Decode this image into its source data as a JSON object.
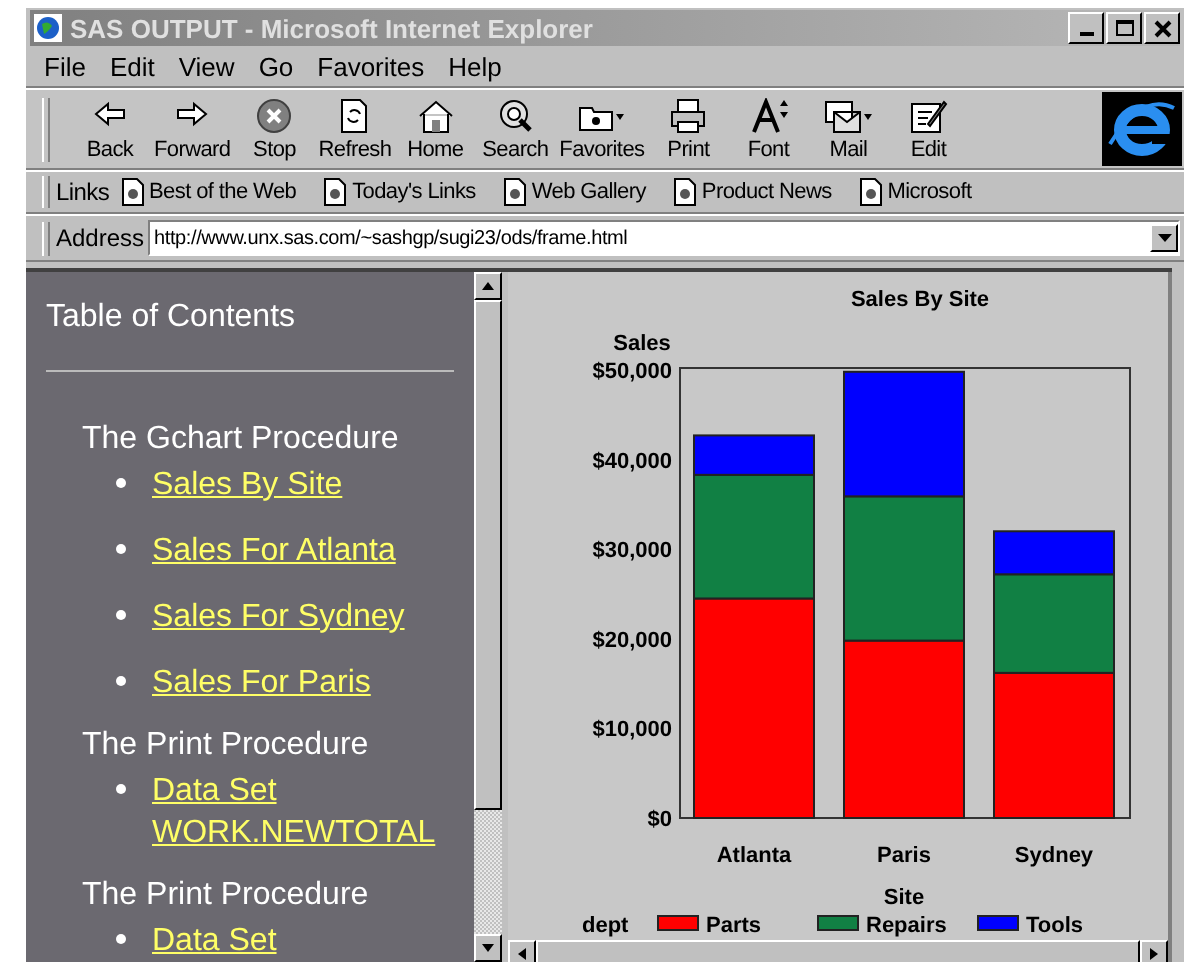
{
  "window": {
    "title": "SAS OUTPUT - Microsoft Internet Explorer"
  },
  "menu": [
    "File",
    "Edit",
    "View",
    "Go",
    "Favorites",
    "Help"
  ],
  "toolbar": [
    {
      "label": "Back",
      "kind": "back"
    },
    {
      "label": "Forward",
      "kind": "forward"
    },
    {
      "label": "Stop",
      "kind": "stop"
    },
    {
      "label": "Refresh",
      "kind": "refresh"
    },
    {
      "label": "Home",
      "kind": "home"
    },
    {
      "label": "Search",
      "kind": "search"
    },
    {
      "label": "Favorites",
      "kind": "favorites"
    },
    {
      "label": "Print",
      "kind": "print"
    },
    {
      "label": "Font",
      "kind": "font"
    },
    {
      "label": "Mail",
      "kind": "mail"
    },
    {
      "label": "Edit",
      "kind": "edit"
    }
  ],
  "links": {
    "label": "Links",
    "items": [
      "Best of the Web",
      "Today's Links",
      "Web Gallery",
      "Product News",
      "Microsoft"
    ]
  },
  "address": {
    "label": "Address",
    "value": "http://www.unx.sas.com/~sashgp/sugi23/ods/frame.html"
  },
  "toc": {
    "title": "Table of Contents",
    "sections": [
      {
        "heading": "The Gchart Procedure",
        "links": [
          "Sales By Site",
          "Sales For Atlanta",
          "Sales For Sydney",
          "Sales For Paris"
        ]
      },
      {
        "heading": "The Print Procedure",
        "links": [
          "Data Set WORK.NEWTOTAL"
        ]
      },
      {
        "heading": "The Print Procedure",
        "links": [
          "Data Set"
        ]
      }
    ]
  },
  "chart": {
    "chart_data": {
      "type": "bar",
      "stacked": true,
      "legend": {
        "title": "dept"
      },
      "title": "Sales By Site",
      "xlabel": "Site",
      "ylabel": "Sales",
      "categories": [
        "Atlanta",
        "Paris",
        "Sydney"
      ],
      "series": [
        {
          "name": "Parts",
          "color": "#ff0000",
          "values": [
            24500,
            19800,
            16200
          ]
        },
        {
          "name": "Repairs",
          "color": "#118044",
          "values": [
            13800,
            16100,
            11000
          ]
        },
        {
          "name": "Tools",
          "color": "#0000ff",
          "values": [
            4400,
            13900,
            4800
          ]
        }
      ],
      "ylim": [
        0,
        50000
      ],
      "yticks": [
        {
          "value": 0,
          "label": "$0"
        },
        {
          "value": 10000,
          "label": "$10,000"
        },
        {
          "value": 20000,
          "label": "$20,000"
        },
        {
          "value": 30000,
          "label": "$30,000"
        },
        {
          "value": 40000,
          "label": "$40,000"
        },
        {
          "value": 50000,
          "label": "$50,000"
        }
      ]
    }
  }
}
